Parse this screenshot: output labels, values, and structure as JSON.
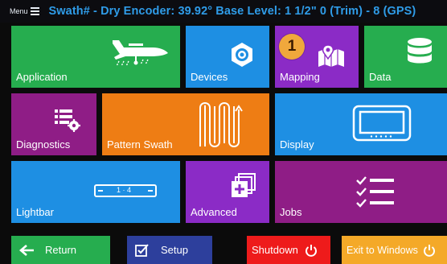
{
  "header": {
    "menu_label": "Menu",
    "title": "Swath# -   Dry Encoder: 39.92°   Base Level: 1 1/2\"  0 (Trim) - 8 (GPS)"
  },
  "tiles": {
    "application": "Application",
    "devices": "Devices",
    "mapping": "Mapping",
    "data": "Data",
    "diagnostics": "Diagnostics",
    "pattern_swath": "Pattern Swath",
    "display": "Display",
    "lightbar": "Lightbar",
    "lightbar_icon_text": "1 · 4",
    "advanced": "Advanced",
    "jobs": "Jobs"
  },
  "annotation": {
    "badge": "1"
  },
  "bottom": {
    "return": "Return",
    "setup": "Setup",
    "shutdown": "Shutdown",
    "exit": "Exit to Windows"
  },
  "colors": {
    "header_text": "#2f9ce8",
    "green": "#26ad4f",
    "blue": "#1e8fe3",
    "purple": "#8b2bc6",
    "magenta": "#8f1d86",
    "orange": "#ee7d14",
    "red": "#ee1b1b",
    "yellow": "#f4a928",
    "setup_blue": "#2d3f9c",
    "badge": "#f0a83c"
  }
}
